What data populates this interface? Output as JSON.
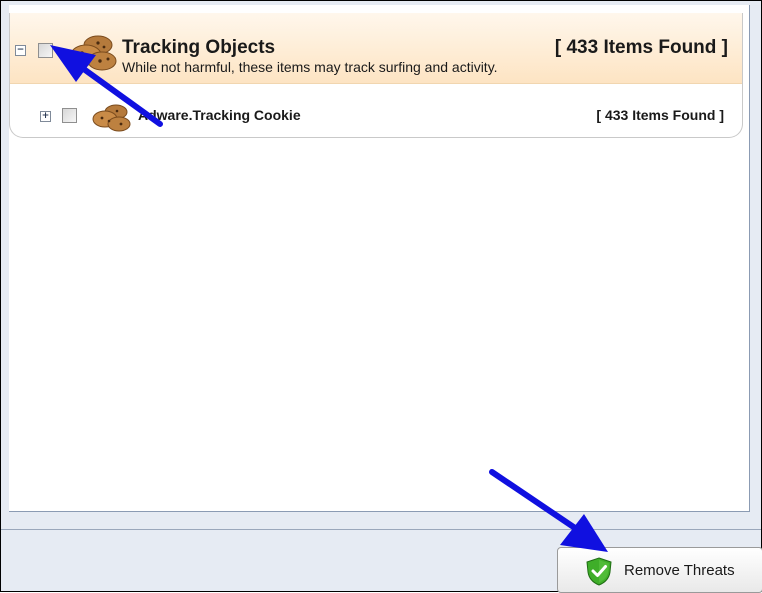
{
  "group": {
    "title": "Tracking Objects",
    "count": "[ 433 Items Found ]",
    "description": "While not harmful, these items may track surfing and activity.",
    "expander_symbol": "−",
    "items": [
      {
        "label": "Adware.Tracking Cookie",
        "count": "[ 433 Items Found ]",
        "expander_symbol": "+"
      }
    ]
  },
  "footer": {
    "remove_button_label": "Remove Threats"
  },
  "colors": {
    "header_bg": "#fde4c3",
    "arrow": "#1010e0",
    "shield_green": "#3fae29"
  },
  "icons": [
    "cookie-icon",
    "shield-check-icon",
    "annotation-arrow"
  ]
}
